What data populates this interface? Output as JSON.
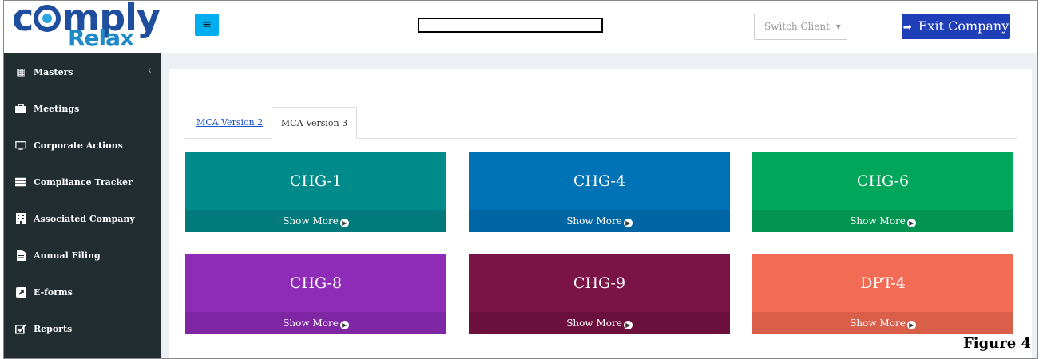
{
  "logo": {
    "word1_pre": "c",
    "word1_post": "mply",
    "word2": "Relax"
  },
  "sidebar": {
    "items": [
      {
        "label": "Masters",
        "icon": "building-icon",
        "glyph": "▦"
      },
      {
        "label": "Meetings",
        "icon": "briefcase-icon",
        "glyph": "💼"
      },
      {
        "label": "Corporate Actions",
        "icon": "monitor-icon",
        "glyph": "▭"
      },
      {
        "label": "Compliance Tracker",
        "icon": "list-icon",
        "glyph": "☰"
      },
      {
        "label": "Associated Company",
        "icon": "building-icon",
        "glyph": "▦"
      },
      {
        "label": "Annual Filing",
        "icon": "file-icon",
        "glyph": "▤"
      },
      {
        "label": "E-forms",
        "icon": "external-link-icon",
        "glyph": "⬈"
      },
      {
        "label": "Reports",
        "icon": "checkbox-icon",
        "glyph": "☑"
      }
    ],
    "chevron": "‹"
  },
  "header": {
    "menu_toggle": "≡",
    "switch_client": "Switch Client",
    "exit_company": "Exit Company"
  },
  "tabs": [
    {
      "label": "MCA Version 2",
      "active": false
    },
    {
      "label": "MCA Version 3",
      "active": true
    }
  ],
  "cards": [
    {
      "title": "CHG-1",
      "more": "Show More",
      "color": "#008b8b",
      "foot": "#007a7a"
    },
    {
      "title": "CHG-4",
      "more": "Show More",
      "color": "#0073b7",
      "foot": "#0066a3"
    },
    {
      "title": "CHG-6",
      "more": "Show More",
      "color": "#00a65a",
      "foot": "#009450"
    },
    {
      "title": "CHG-8",
      "more": "Show More",
      "color": "#8e2cb8",
      "foot": "#7e26a4"
    },
    {
      "title": "CHG-9",
      "more": "Show More",
      "color": "#7b1446",
      "foot": "#6b103c"
    },
    {
      "title": "DPT-4",
      "more": "Show More",
      "color": "#f26b55",
      "foot": "#d95f4b"
    }
  ],
  "figure_label": "Figure 4"
}
